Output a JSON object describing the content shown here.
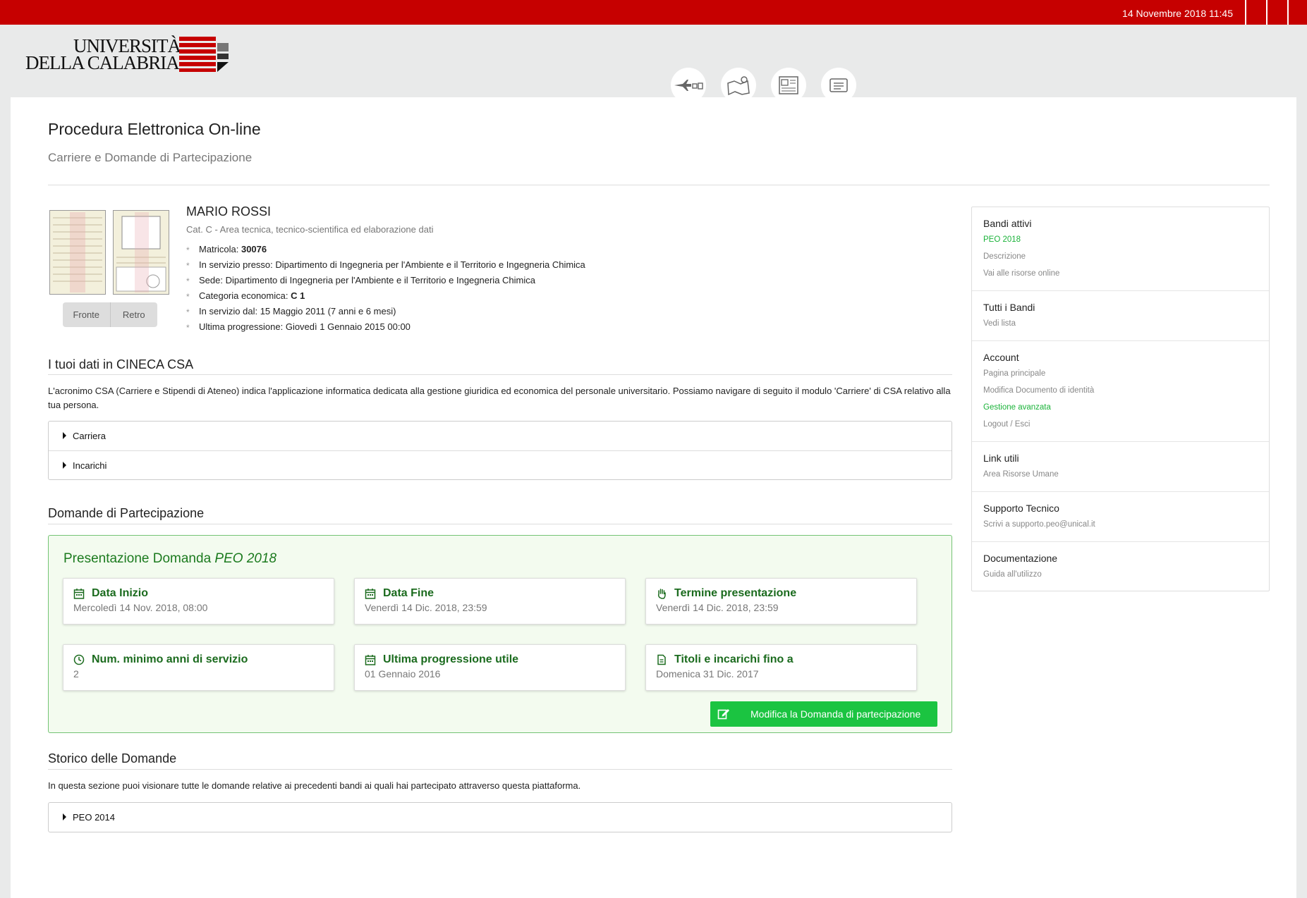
{
  "topbar": {
    "datetime": "14 Novembre 2018 11:45"
  },
  "logo": {
    "line1": "UNIVERSITÀ",
    "line2": "DELLA CALABRIA"
  },
  "header_icons": [
    "travel-icon",
    "map-icon",
    "news-icon",
    "card-icon"
  ],
  "page": {
    "title": "Procedura Elettronica On-line",
    "subtitle": "Carriere e Domande di Partecipazione"
  },
  "profile": {
    "id_buttons": {
      "front": "Fronte",
      "back": "Retro"
    },
    "name": "MARIO ROSSI",
    "role": "Cat. C - Area tecnica, tecnico-scientifica ed elaborazione dati",
    "facts": [
      {
        "label": "Matricola: ",
        "value": "30076",
        "bold": true
      },
      {
        "label": "In servizio presso: Dipartimento di Ingegneria per l'Ambiente e il Territorio e Ingegneria Chimica",
        "value": ""
      },
      {
        "label": "Sede: Dipartimento di Ingegneria per l'Ambiente e il Territorio e Ingegneria Chimica",
        "value": ""
      },
      {
        "label": "Categoria economica: ",
        "value": "C 1",
        "bold": true
      },
      {
        "label": "In servizio dal: 15 Maggio 2011 (7 anni e 6 mesi)",
        "value": ""
      },
      {
        "label": "Ultima progressione: Giovedì 1 Gennaio 2015 00:00",
        "value": ""
      }
    ]
  },
  "csa": {
    "title": "I tuoi dati in CINECA CSA",
    "description": "L'acronimo CSA (Carriere e Stipendi di Ateneo) indica l'applicazione informatica dedicata alla gestione giuridica ed economica del personale universitario. Possiamo navigare di seguito il modulo 'Carriere' di CSA relativo alla tua persona.",
    "items": [
      "Carriera",
      "Incarichi"
    ]
  },
  "domande": {
    "title": "Domande di Partecipazione",
    "box_title": "Presentazione Domanda ",
    "box_title_em": "PEO 2018",
    "cards": [
      {
        "icon": "calendar-icon",
        "title": "Data Inizio",
        "value": "Mercoledì 14 Nov. 2018, 08:00"
      },
      {
        "icon": "calendar-icon",
        "title": "Data Fine",
        "value": "Venerdì 14 Dic. 2018, 23:59"
      },
      {
        "icon": "hand-icon",
        "title": "Termine presentazione",
        "value": "Venerdì 14 Dic. 2018, 23:59"
      },
      {
        "icon": "clock-icon",
        "title": "Num. minimo anni di servizio",
        "value": "2"
      },
      {
        "icon": "calendar-icon",
        "title": "Ultima progressione utile",
        "value": "01 Gennaio 2016"
      },
      {
        "icon": "document-icon",
        "title": "Titoli e incarichi fino a",
        "value": "Domenica 31 Dic. 2017"
      }
    ],
    "edit_button": "Modifica la Domanda di partecipazione"
  },
  "storico": {
    "title": "Storico delle Domande",
    "description": "In questa sezione puoi visionare tutte le domande relative ai precedenti bandi ai quali hai partecipato attraverso questa piattaforma.",
    "items": [
      "PEO 2014"
    ]
  },
  "sidebar": {
    "groups": [
      {
        "title": "Bandi attivi",
        "links": [
          {
            "label": "PEO 2018",
            "active": true
          },
          {
            "label": "Descrizione"
          },
          {
            "label": "Vai alle risorse online"
          }
        ]
      },
      {
        "title": "Tutti i Bandi",
        "links": [
          {
            "label": "Vedi lista"
          }
        ]
      },
      {
        "title": "Account",
        "links": [
          {
            "label": "Pagina principale"
          },
          {
            "label": "Modifica Documento di identità"
          },
          {
            "label": "Gestione avanzata",
            "active": true
          },
          {
            "label": "Logout / Esci"
          }
        ]
      },
      {
        "title": "Link utili",
        "links": [
          {
            "label": "Area Risorse Umane"
          }
        ]
      },
      {
        "title": "Supporto Tecnico",
        "links": [
          {
            "label": "Scrivi a supporto.peo@unical.it"
          }
        ]
      },
      {
        "title": "Documentazione",
        "links": [
          {
            "label": "Guida all'utilizzo"
          }
        ]
      }
    ]
  },
  "colors": {
    "brand_red": "#c60000",
    "success_green": "#1bc441",
    "title_green": "#1c7b1f"
  }
}
